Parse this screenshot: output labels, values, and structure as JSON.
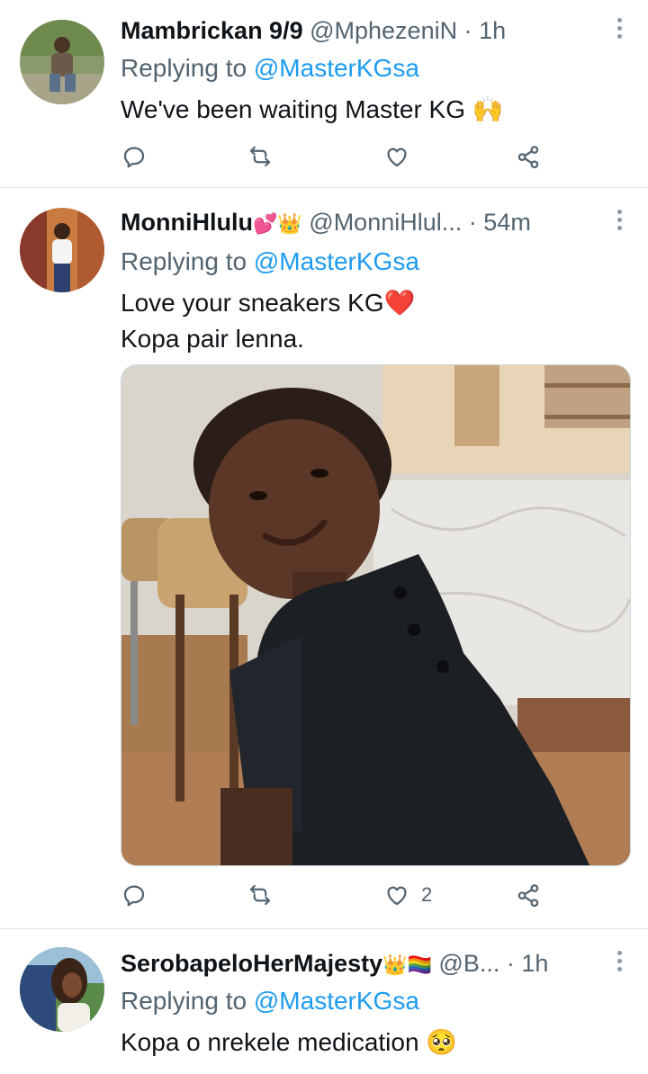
{
  "tweets": [
    {
      "display_name": "Mambrickan 9/9",
      "name_emoji": "",
      "handle": "@MphezeniN",
      "time": "1h",
      "replying_label": "Replying to",
      "replying_to": "@MasterKGsa",
      "text_lines": [
        "We've been waiting Master KG 🙌"
      ],
      "like_count": ""
    },
    {
      "display_name": "MonniHlulu",
      "name_emoji": "💕👑",
      "handle": "@MonniHlul...",
      "time": "54m",
      "replying_label": "Replying to",
      "replying_to": "@MasterKGsa",
      "text_lines": [
        "Love your sneakers KG❤️",
        "Kopa pair lenna."
      ],
      "like_count": "2"
    },
    {
      "display_name": "SerobapeloHerMajesty",
      "name_emoji": "👑🏳️‍🌈",
      "handle": "@B...",
      "time": "1h",
      "replying_label": "Replying to",
      "replying_to": "@MasterKGsa",
      "text_lines": [
        "Kopa o nrekele medication 🥺"
      ],
      "like_count": ""
    }
  ],
  "icons": {
    "reply": "reply-icon",
    "retweet": "retweet-icon",
    "like": "heart-icon",
    "share": "share-icon",
    "more": "more-icon"
  },
  "colors": {
    "link": "#1d9bf0",
    "secondary": "#536471",
    "text": "#0f1419",
    "divider": "#e4e8eb"
  }
}
